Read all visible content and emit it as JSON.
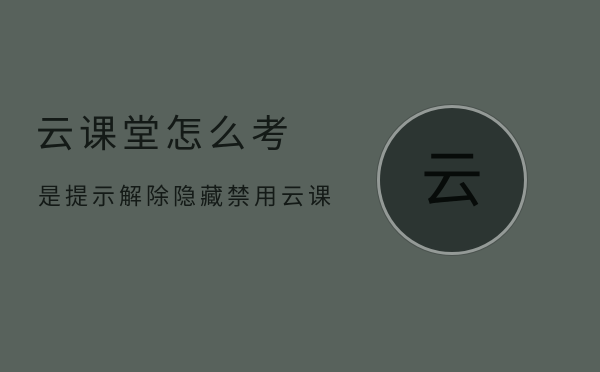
{
  "banner": {
    "title": "云课堂怎么考",
    "subtitle": "是提示解除隐藏禁用云课",
    "seal_char": "云",
    "colors": {
      "background": "#58625c",
      "text": "#141a17",
      "seal_fill": "#2c3532",
      "seal_ring": "#949a97"
    }
  }
}
